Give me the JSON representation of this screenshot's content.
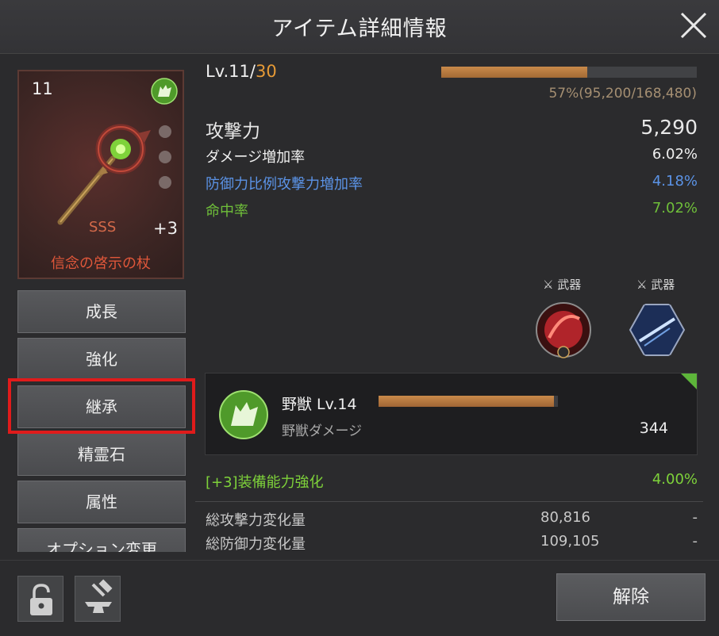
{
  "header": {
    "title": "アイテム詳細情報"
  },
  "item": {
    "level_badge": "11",
    "grade": "SSS",
    "enhance": "+3",
    "name": "信念の啓示の杖",
    "element_icon": "wolf-icon",
    "colors": {
      "name": "#e0573a",
      "grade": "#d46a4a"
    }
  },
  "level": {
    "prefix": "Lv.11/",
    "max": "30",
    "progress_fraction": 0.57,
    "exp_text": "57%(95,200/168,480)"
  },
  "stats": [
    {
      "label": "攻撃力",
      "value": "5,290",
      "color": "#f0f0f0"
    },
    {
      "label": "ダメージ増加率",
      "value": "6.02%",
      "color": "#f0f0f0"
    },
    {
      "label": "防御力比例攻撃力増加率",
      "value": "4.18%",
      "color": "#5b93e6"
    },
    {
      "label": "命中率",
      "value": "7.02%",
      "color": "#6fbf3a"
    }
  ],
  "skills": [
    {
      "tag": "武器",
      "icon": "red-slash-skill-icon"
    },
    {
      "tag": "武器",
      "icon": "blue-slash-skill-icon"
    }
  ],
  "beast": {
    "name": "野獣 Lv.14",
    "progress_fraction": 0.98,
    "sub_label": "野獣ダメージ",
    "value": "344"
  },
  "bonus": {
    "label": "[+3]装備能力強化",
    "value": "4.00%",
    "color": "#7ed23a"
  },
  "totals": [
    {
      "label": "総攻撃力変化量",
      "value": "80,816",
      "trail": "-"
    },
    {
      "label": "総防御力変化量",
      "value": "109,105",
      "trail": "-"
    }
  ],
  "menu": [
    "成長",
    "強化",
    "継承",
    "精霊石",
    "属性",
    "オプション変更"
  ],
  "footer": {
    "release_label": "解除",
    "icons": [
      "lock-icon",
      "anvil-icon"
    ]
  }
}
